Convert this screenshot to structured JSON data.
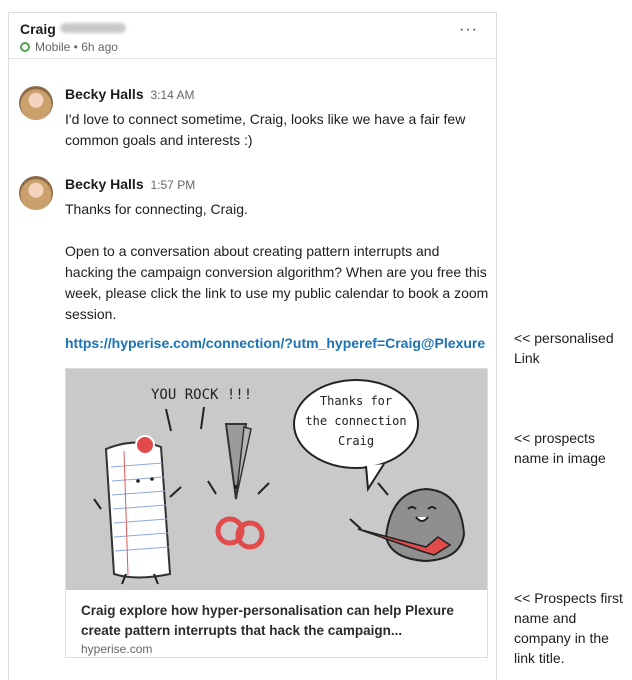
{
  "header": {
    "name": "Craig",
    "status": "Mobile • 6h ago",
    "more_label": "···"
  },
  "messages": [
    {
      "sender": "Becky Halls",
      "time": "3:14 AM",
      "paragraphs": [
        "I'd love to connect sometime, Craig, looks like we have a fair few common goals and interests :)"
      ]
    },
    {
      "sender": "Becky Halls",
      "time": "1:57 PM",
      "paragraphs": [
        "Thanks for connecting, Craig.",
        "Open to a conversation about creating pattern interrupts and hacking the campaign conversion algorithm? When are you free this week, please click the link to use my public calendar to book a zoom session."
      ],
      "link": "https://hyperise.com/connection/?utm_hyperef=Craig@Plexure"
    }
  ],
  "card": {
    "image_text": {
      "left_caption": "YOU ROCK !!!",
      "bubble_line1": "Thanks for",
      "bubble_line2": "the connection",
      "bubble_line3": "Craig"
    },
    "title": "Craig explore how hyper-personalisation can help Plexure create pattern interrupts that hack the campaign...",
    "domain": "hyperise.com"
  },
  "annotations": {
    "link_note": "<< personalised Link",
    "image_note": "<< prospects name in image",
    "title_note": "<< Prospects first name and company in the link title."
  },
  "colors": {
    "link": "#1a73b5",
    "status_dot": "#52a14d",
    "image_bg": "#c9c9c9"
  }
}
